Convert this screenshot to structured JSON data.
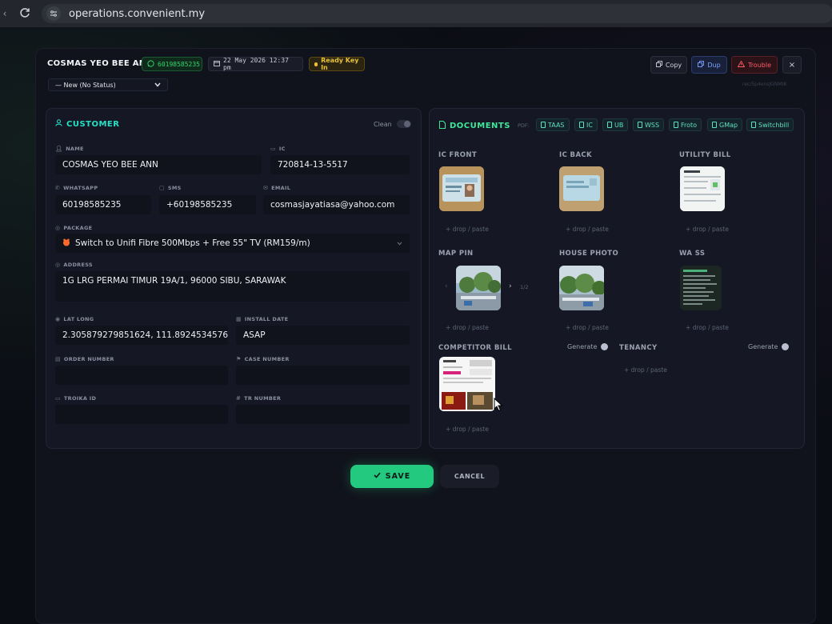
{
  "browser": {
    "url": "operations.convenient.my"
  },
  "header": {
    "customer_name": "COSMAS YEO BEE ANN",
    "whatsapp": "60198585235",
    "datetime": "22 May 2026 12:37 pm",
    "status_badge": "Ready Key In",
    "status_select": "— New (No Status)",
    "copy_label": "Copy",
    "dup_label": "Dup",
    "trouble_label": "Trouble",
    "close_label": "×",
    "record_id": "rec/5p4ensJGNMI8",
    "colors": {
      "accent": "#26e0c6",
      "docs_accent": "#3ee89a",
      "trouble": "#ff5a6a",
      "dup": "#7ea3ff",
      "ready": "#e8c13a"
    }
  },
  "customer": {
    "title": "CUSTOMER",
    "clean_label": "Clean",
    "name_label": "NAME",
    "name_value": "COSMAS YEO BEE ANN",
    "ic_label": "IC",
    "ic_value": "720814-13-5517",
    "whatsapp_label": "WHATSAPP",
    "whatsapp_value": "60198585235",
    "sms_label": "SMS",
    "sms_value": "+60198585235",
    "email_label": "EMAIL",
    "email_value": "cosmasjayatiasa@yahoo.com",
    "package_label": "PACKAGE",
    "package_value": "Switch to Unifi Fibre 500Mbps + Free 55\" TV (RM159/m)",
    "address_label": "ADDRESS",
    "address_value": "1G LRG PERMAI TIMUR 19A/1, 96000 SIBU, SARAWAK",
    "latlong_label": "LAT LONG",
    "latlong_value": "2.305879279851624, 111.892453457671",
    "install_date_label": "INSTALL DATE",
    "install_date_value": "ASAP",
    "order_number_label": "ORDER NUMBER",
    "case_number_label": "CASE NUMBER",
    "troika_label": "TROIKA ID",
    "tr_number_label": "TR NUMBER"
  },
  "documents": {
    "title": "DOCUMENTS",
    "pdf_label": "PDF:",
    "pdf_chips": [
      "TAAS",
      "IC",
      "UB",
      "WSS",
      "Froto",
      "GMap",
      "Switchbill"
    ],
    "slots": {
      "ic_front": "IC FRONT",
      "ic_back": "IC BACK",
      "utility_bill": "UTILITY BILL",
      "map_pin": "MAP PIN",
      "house_photo": "HOUSE PHOTO",
      "wa_ss": "WA SS",
      "competitor_bill": "COMPETITOR BILL",
      "tenancy": "TENANCY"
    },
    "drop_text": "+ drop / paste",
    "map_counter": "1/2",
    "generate_label": "Generate"
  },
  "footer": {
    "save_label": "SAVE",
    "cancel_label": "CANCEL"
  }
}
